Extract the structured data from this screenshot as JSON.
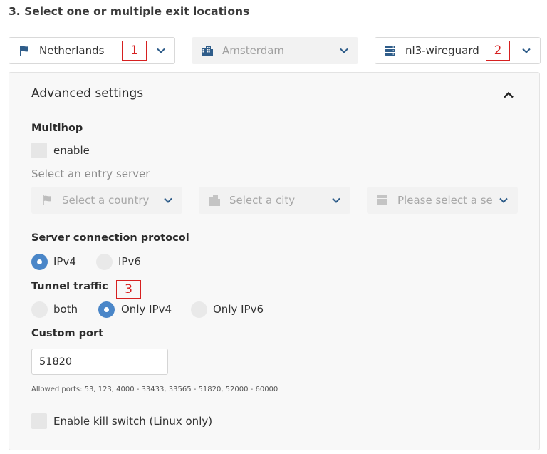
{
  "section": {
    "title": "3. Select one or multiple exit locations"
  },
  "exit": {
    "country": {
      "value": "Netherlands",
      "icon": "flag-icon"
    },
    "city": {
      "value": "Amsterdam",
      "icon": "city-icon"
    },
    "server": {
      "value": "nl3-wireguard",
      "icon": "server-icon"
    }
  },
  "annotations": {
    "a1": "1",
    "a2": "2",
    "a3": "3"
  },
  "advanced": {
    "title": "Advanced settings",
    "multihop": {
      "label": "Multihop",
      "enable_label": "enable",
      "entry_label": "Select an entry server",
      "country_placeholder": "Select a country",
      "city_placeholder": "Select a city",
      "server_placeholder": "Please select a serv"
    },
    "protocol": {
      "label": "Server connection protocol",
      "options": [
        "IPv4",
        "IPv6"
      ],
      "selected": "IPv4"
    },
    "tunnel": {
      "label": "Tunnel traffic",
      "options": [
        "both",
        "Only IPv4",
        "Only IPv6"
      ],
      "selected": "Only IPv4"
    },
    "port": {
      "label": "Custom port",
      "value": "51820",
      "hint": "Allowed ports: 53, 123, 4000 - 33433, 33565 - 51820, 52000 - 60000"
    },
    "killswitch": {
      "label": "Enable kill switch (Linux only)"
    }
  },
  "colors": {
    "accent": "#4a86c8",
    "chevron": "#2f5d8a",
    "annotation": "#d62020"
  }
}
